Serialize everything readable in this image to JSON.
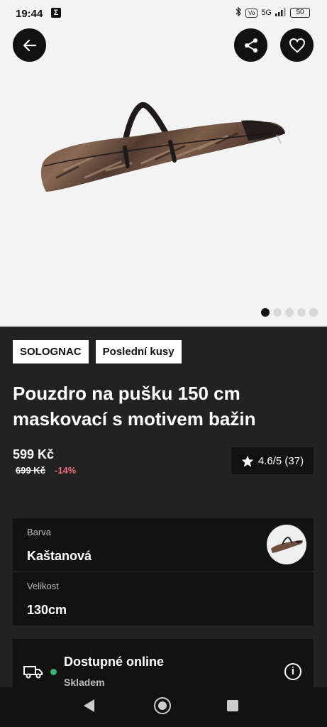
{
  "status_bar": {
    "time": "19:44",
    "app_glyph": "Σ",
    "network": "5G",
    "battery": "50",
    "icons": [
      "bluetooth-icon",
      "volte-icon",
      "signal-icon",
      "battery-icon"
    ]
  },
  "header": {
    "back_icon": "arrow-left-icon",
    "share_icon": "share-icon",
    "favorite_icon": "heart-icon"
  },
  "gallery": {
    "image_count": 5,
    "active_index": 0
  },
  "tags": [
    "SOLOGNAC",
    "Poslední kusy"
  ],
  "product": {
    "title": "Pouzdro na pušku 150 cm maskovací s motivem bažin",
    "price": "599 Kč",
    "old_price": "699 Kč",
    "discount": "-14%",
    "rating": "4.6/5 (37)"
  },
  "variants": {
    "color_label": "Barva",
    "color_value": "Kaštanová",
    "size_label": "Velikost",
    "size_value": "130cm"
  },
  "availability": {
    "title": "Dostupné online",
    "subtitle": "Skladem",
    "status_color": "#3cb371"
  },
  "colors": {
    "dark_bg": "#222223",
    "panel_bg": "#121212",
    "discount": "#ef6a7d"
  }
}
